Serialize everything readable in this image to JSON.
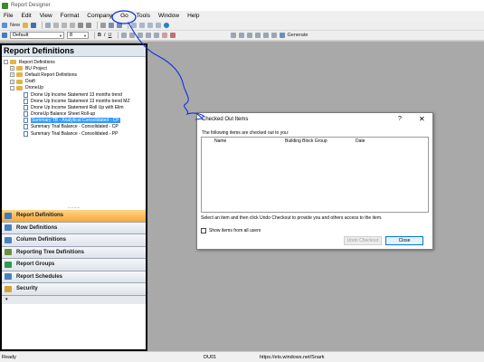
{
  "app": {
    "title": "Report Designer",
    "icon": "app-icon"
  },
  "menu": [
    "File",
    "Edit",
    "View",
    "Format",
    "Company",
    "Go",
    "Tools",
    "Window",
    "Help"
  ],
  "toolbar": {
    "new_label": "New",
    "generate_label": "Generate",
    "style_combo_value": "Default",
    "size_combo_value": "8"
  },
  "left_panel": {
    "header": "Report Definitions",
    "tree": [
      {
        "label": "Report Definitions",
        "type": "folder",
        "level": 0,
        "toggle": "-"
      },
      {
        "label": "BU Project",
        "type": "folder",
        "level": 1,
        "toggle": "+"
      },
      {
        "label": "Default Report Definitions",
        "type": "folder",
        "level": 1,
        "toggle": "+"
      },
      {
        "label": "Draft",
        "type": "folder",
        "level": 1,
        "toggle": "+"
      },
      {
        "label": "DroneUp",
        "type": "folder",
        "level": 1,
        "toggle": "-"
      },
      {
        "label": "Drone Up Income Statement 13 months trend",
        "type": "doc",
        "level": 2
      },
      {
        "label": "Drone Up Income Statement 13 months trend MZ",
        "type": "doc",
        "level": 2
      },
      {
        "label": "Drone Up Income Statement Roll Up with Elim",
        "type": "doc",
        "level": 2
      },
      {
        "label": "DroneUp Balance Sheet Roll-up",
        "type": "doc",
        "level": 2
      },
      {
        "label": "Summary TB - Analytical Consolidated - CP",
        "type": "doc",
        "level": 2,
        "selected": true
      },
      {
        "label": "Summary Trial Balance - Consolidated - CP",
        "type": "doc",
        "level": 2
      },
      {
        "label": "Summary Trial Balance - Consolidated - PP",
        "type": "doc",
        "level": 2
      }
    ],
    "splitter": "..........",
    "nav_buttons": [
      {
        "label": "Report Definitions",
        "active": true,
        "color": "#3d7bc7"
      },
      {
        "label": "Row Definitions",
        "active": false,
        "color": "#4a7fc1"
      },
      {
        "label": "Column Definitions",
        "active": false,
        "color": "#4a7fc1"
      },
      {
        "label": "Reporting Tree Definitions",
        "active": false,
        "color": "#6b8f3a"
      },
      {
        "label": "Report Groups",
        "active": false,
        "color": "#2f9a4a"
      },
      {
        "label": "Report Schedules",
        "active": false,
        "color": "#4a7fc1"
      },
      {
        "label": "Security",
        "active": false,
        "color": "#d4a23a"
      }
    ],
    "overflow": "▾"
  },
  "dialog": {
    "title": "Checked Out Items",
    "help": "?",
    "close": "✕",
    "description": "The following items are checked out to you:",
    "columns": [
      "Name",
      "Building Block Group",
      "Date"
    ],
    "hint": "Select an item and then click Undo Checkout to provide you and others access to the item.",
    "checkbox_label": "Show items from all users",
    "undo_label": "Undo Checkout",
    "close_label": "Close"
  },
  "status": {
    "left": "Ready",
    "middle": "DU01",
    "right": "https://ets.windows.net/Snark"
  },
  "colors": {
    "annotation": "#1030e0",
    "selection": "#3399ff",
    "active_nav": "#f5a93c"
  }
}
